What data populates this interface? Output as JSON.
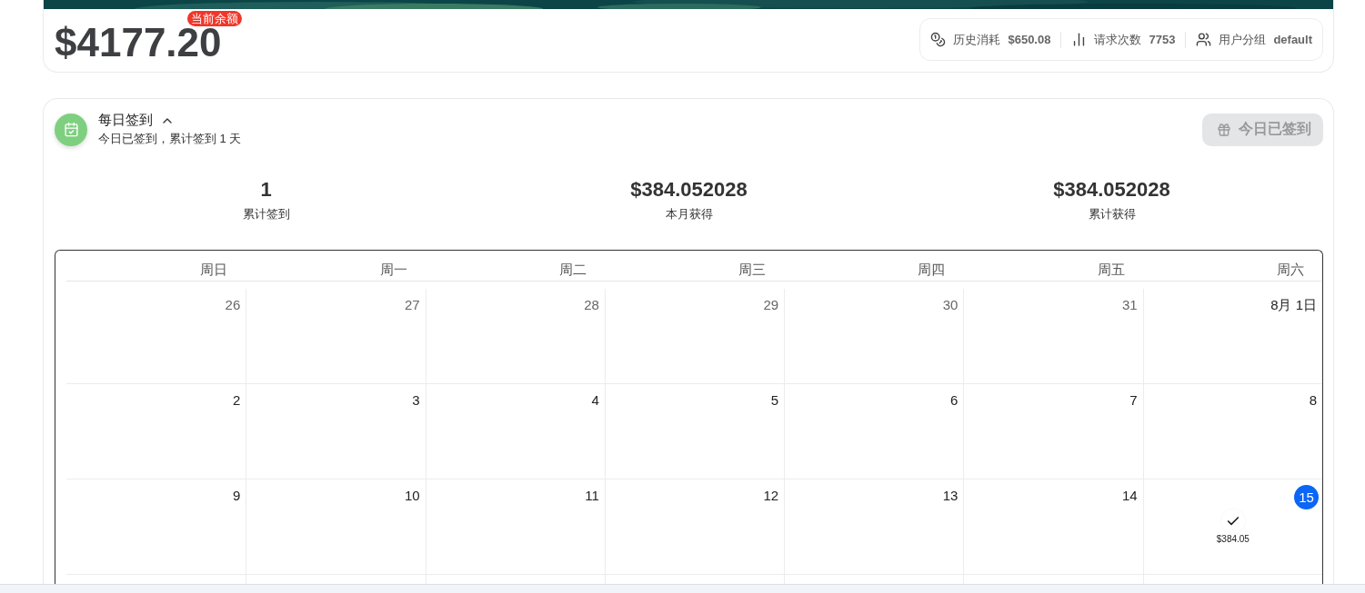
{
  "balance": {
    "amount": "$4177.20",
    "badge": "当前余额"
  },
  "stats": [
    {
      "kind": "coins",
      "label": "历史消耗",
      "value": "$650.08"
    },
    {
      "kind": "chart",
      "label": "请求次数",
      "value": "7753"
    },
    {
      "kind": "users",
      "label": "用户分组",
      "value": "default"
    }
  ],
  "checkin": {
    "title": "每日签到",
    "expanded": true,
    "subtitle": "今日已签到，累计签到 1 天",
    "button": {
      "label": "今日已签到",
      "disabled": true
    },
    "summary": [
      {
        "value": "1",
        "label": "累计签到"
      },
      {
        "value": "$384.052028",
        "label": "本月获得"
      },
      {
        "value": "$384.052028",
        "label": "累计获得"
      }
    ],
    "calendar": {
      "weekdays": [
        "周日",
        "周一",
        "周二",
        "周三",
        "周四",
        "周五",
        "周六"
      ],
      "days": [
        {
          "label": "26",
          "outside": true,
          "today": false,
          "signed": false
        },
        {
          "label": "27",
          "outside": true,
          "today": false,
          "signed": false
        },
        {
          "label": "28",
          "outside": true,
          "today": false,
          "signed": false
        },
        {
          "label": "29",
          "outside": true,
          "today": false,
          "signed": false
        },
        {
          "label": "30",
          "outside": true,
          "today": false,
          "signed": false
        },
        {
          "label": "31",
          "outside": true,
          "today": false,
          "signed": false
        },
        {
          "label": "8月 1日",
          "outside": false,
          "today": false,
          "signed": false
        },
        {
          "label": "2",
          "outside": false,
          "today": false,
          "signed": false
        },
        {
          "label": "3",
          "outside": false,
          "today": false,
          "signed": false
        },
        {
          "label": "4",
          "outside": false,
          "today": false,
          "signed": false
        },
        {
          "label": "5",
          "outside": false,
          "today": false,
          "signed": false
        },
        {
          "label": "6",
          "outside": false,
          "today": false,
          "signed": false
        },
        {
          "label": "7",
          "outside": false,
          "today": false,
          "signed": false
        },
        {
          "label": "8",
          "outside": false,
          "today": false,
          "signed": false
        },
        {
          "label": "9",
          "outside": false,
          "today": false,
          "signed": false
        },
        {
          "label": "10",
          "outside": false,
          "today": false,
          "signed": false
        },
        {
          "label": "11",
          "outside": false,
          "today": false,
          "signed": false
        },
        {
          "label": "12",
          "outside": false,
          "today": false,
          "signed": false
        },
        {
          "label": "13",
          "outside": false,
          "today": false,
          "signed": false
        },
        {
          "label": "14",
          "outside": false,
          "today": false,
          "signed": false
        },
        {
          "label": "15",
          "outside": false,
          "today": true,
          "signed": true,
          "reward": "$384.05"
        }
      ]
    }
  }
}
